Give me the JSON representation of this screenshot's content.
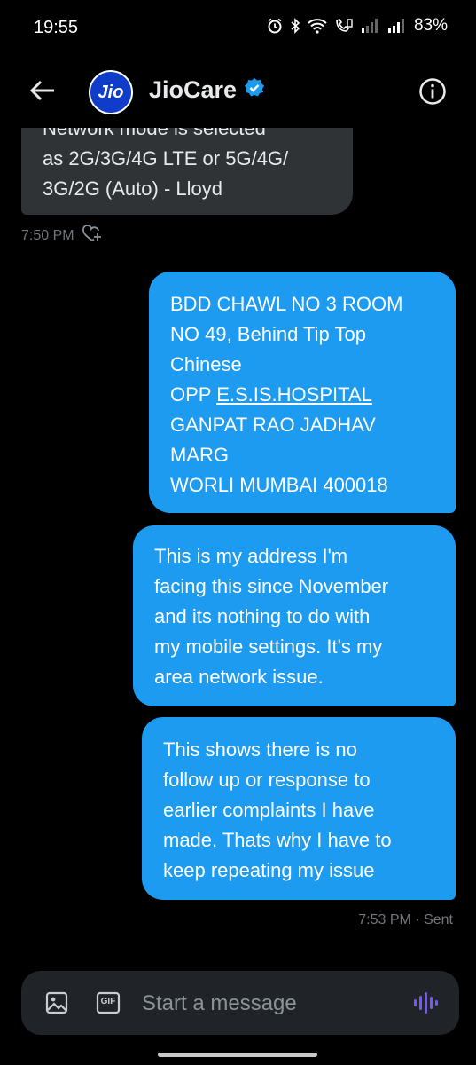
{
  "status_bar": {
    "time": "19:55",
    "battery": "83%",
    "icons": [
      "alarm-icon",
      "bluetooth-icon",
      "wifi-icon",
      "volte-icon",
      "signal-icon",
      "signal-icon"
    ]
  },
  "header": {
    "avatar_text": "Jio",
    "title": "JioCare",
    "verified": true,
    "back_icon": "arrow-left-icon",
    "info_icon": "info-icon"
  },
  "messages": [
    {
      "direction": "incoming",
      "lines": [
        "Network mode is selected",
        "as 2G/3G/4G LTE or 5G/4G/",
        "3G/2G (Auto) - Lloyd"
      ],
      "time": "7:50 PM",
      "react_icon": "heart-plus-icon"
    },
    {
      "direction": "outgoing",
      "lines": [
        "BDD CHAWL NO 3 ROOM",
        "NO 49, Behind Tip Top",
        "Chinese"
      ],
      "link_line": {
        "prefix": "OPP ",
        "link": "E.S.IS.HOSPITAL"
      },
      "lines_after": [
        "GANPAT RAO JADHAV",
        "MARG",
        "WORLI MUMBAI 400018"
      ]
    },
    {
      "direction": "outgoing",
      "lines": [
        "This is my address I'm",
        "facing this since November",
        "and its nothing to do with",
        "my mobile settings. It's my",
        "area network issue."
      ]
    },
    {
      "direction": "outgoing",
      "lines": [
        "This shows there is no",
        "follow up or response to",
        "earlier complaints I have",
        "made. Thats why I have to",
        "keep repeating my issue"
      ],
      "time": "7:53 PM · Sent"
    }
  ],
  "composer": {
    "placeholder": "Start a message",
    "image_icon": "image-icon",
    "gif_label": "GIF",
    "voice_icon": "voice-wave-icon"
  },
  "colors": {
    "background": "#000000",
    "incoming_bubble": "#2f3336",
    "outgoing_bubble": "#1d9bf0",
    "accent_purple": "#7856ff",
    "verified_blue": "#1d9bf0"
  }
}
